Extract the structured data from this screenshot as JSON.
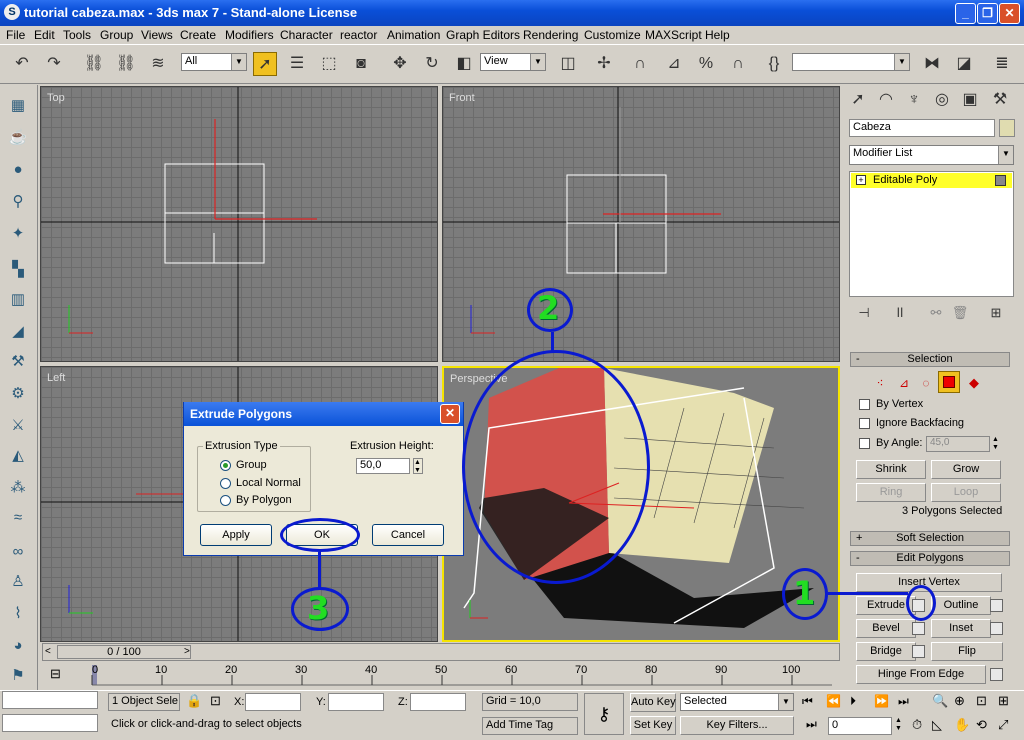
{
  "window": {
    "title": "tutorial cabeza.max - 3ds max 7  - Stand-alone License",
    "logo": "S"
  },
  "menu": [
    "File",
    "Edit",
    "Tools",
    "Group",
    "Views",
    "Create",
    "Modifiers",
    "Character",
    "reactor",
    "Animation",
    "Graph Editors",
    "Rendering",
    "Customize",
    "MAXScript",
    "Help"
  ],
  "toolbar": {
    "selection_filter": "All",
    "ref_coord": "View"
  },
  "viewports": {
    "top": "Top",
    "front": "Front",
    "left": "Left",
    "perspective": "Perspective"
  },
  "command_panel": {
    "object_name": "Cabeza",
    "modifier_list": "Modifier List",
    "stack_item": "Editable Poly",
    "selection_rollout": "Selection",
    "by_vertex": "By Vertex",
    "ignore_backfacing": "Ignore Backfacing",
    "by_angle": "By Angle:",
    "by_angle_value": "45,0",
    "shrink": "Shrink",
    "grow": "Grow",
    "ring": "Ring",
    "loop": "Loop",
    "selected_info": "3 Polygons Selected",
    "soft_selection": "Soft Selection",
    "edit_polygons": "Edit Polygons",
    "insert_vertex": "Insert Vertex",
    "extrude": "Extrude",
    "outline": "Outline",
    "bevel": "Bevel",
    "inset": "Inset",
    "bridge": "Bridge",
    "flip": "Flip",
    "hinge_from_edge": "Hinge From Edge"
  },
  "dialog": {
    "title": "Extrude Polygons",
    "extrusion_type": "Extrusion Type",
    "options": [
      "Group",
      "Local Normal",
      "By Polygon"
    ],
    "selected_option": "Group",
    "extrusion_height_label": "Extrusion Height:",
    "extrusion_height": "50,0",
    "apply": "Apply",
    "ok": "OK",
    "cancel": "Cancel"
  },
  "timeline": {
    "frame": "0 / 100",
    "ticks": [
      "0",
      "10",
      "20",
      "30",
      "40",
      "50",
      "60",
      "70",
      "80",
      "90",
      "100"
    ]
  },
  "status": {
    "object_count": "1 Object Sele",
    "x_label": "X:",
    "y_label": "Y:",
    "z_label": "Z:",
    "grid": "Grid = 10,0",
    "prompt": "Click or click-and-drag to select objects",
    "add_time_tag": "Add Time Tag",
    "auto_key": "Auto Key",
    "set_key": "Set Key",
    "selected": "Selected",
    "key_filters": "Key Filters...",
    "frame_field": "0"
  },
  "annotations": [
    "1",
    "2",
    "3"
  ],
  "colors": {
    "accent": "#f5e400",
    "annotation_ring": "#0a1ad0",
    "annotation_number": "#22dd22"
  }
}
